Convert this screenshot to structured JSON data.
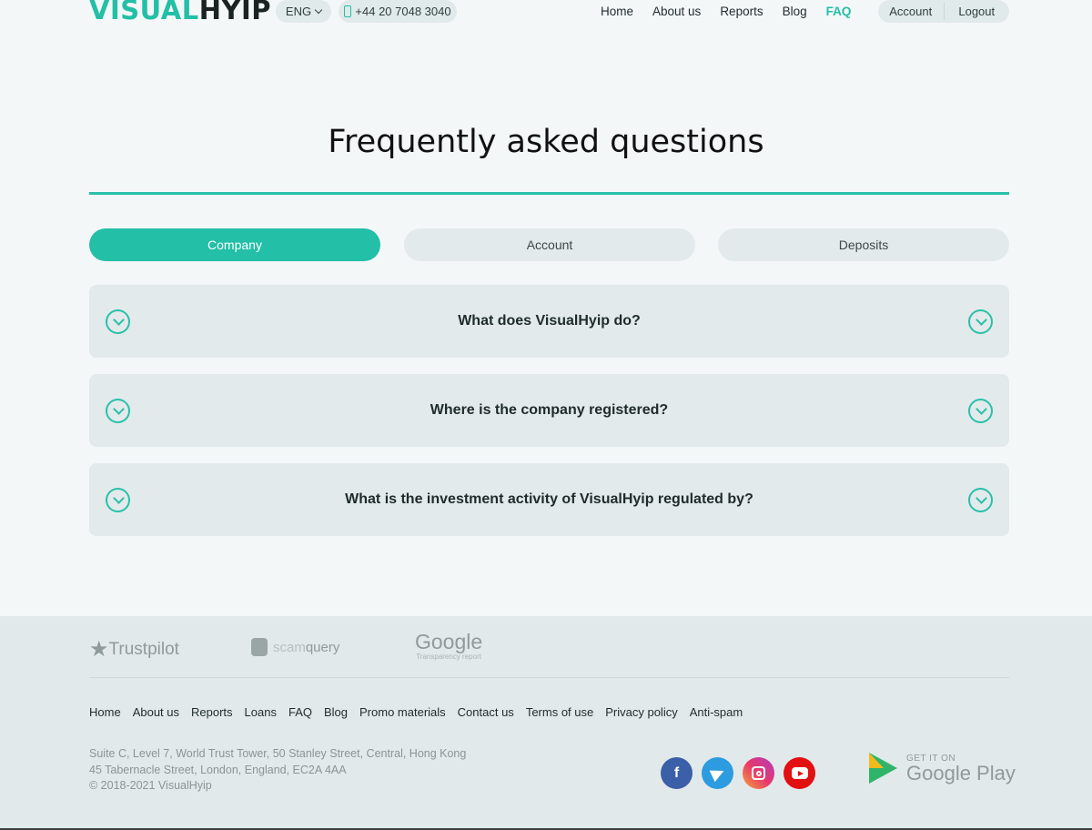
{
  "header": {
    "logo_part1": "VISUAL",
    "logo_part2": "HYIP",
    "language": "ENG",
    "phone": "+44 20 7048 3040",
    "nav": [
      "Home",
      "About us",
      "Reports",
      "Blog",
      "FAQ"
    ],
    "account": "Account",
    "logout": "Logout"
  },
  "main": {
    "title": "Frequently asked questions",
    "tabs": [
      "Company",
      "Account",
      "Deposits"
    ],
    "active_tab": "Company",
    "questions": [
      "What does VisualHyip do?",
      "Where is the company registered?",
      "What is the investment activity of VisualHyip regulated by?"
    ]
  },
  "footer": {
    "partners": {
      "trustpilot": "Trustpilot",
      "scamquery_a": "scam",
      "scamquery_b": "query",
      "google": "Google",
      "google_sub": "Transparency report"
    },
    "links": [
      "Home",
      "About us",
      "Reports",
      "Loans",
      "FAQ",
      "Blog",
      "Promo materials",
      "Contact us",
      "Terms of use",
      "Privacy policy",
      "Anti-spam"
    ],
    "address_line1": "Suite C, Level 7, World Trust Tower, 50 Stanley Street, Central, Hong Kong",
    "address_line2": "45 Tabernacle Street, London, England, EC2A 4AA",
    "copyright": "© 2018-2021 VisualHyip",
    "social": [
      "facebook-icon",
      "telegram-icon",
      "instagram-icon",
      "youtube-icon"
    ],
    "google_play_top": "GET IT ON",
    "google_play_main": "Google Play"
  },
  "colors": {
    "accent": "#23bfa7",
    "background": "#f4f7f8",
    "footer_bg": "#e2e9ea"
  }
}
